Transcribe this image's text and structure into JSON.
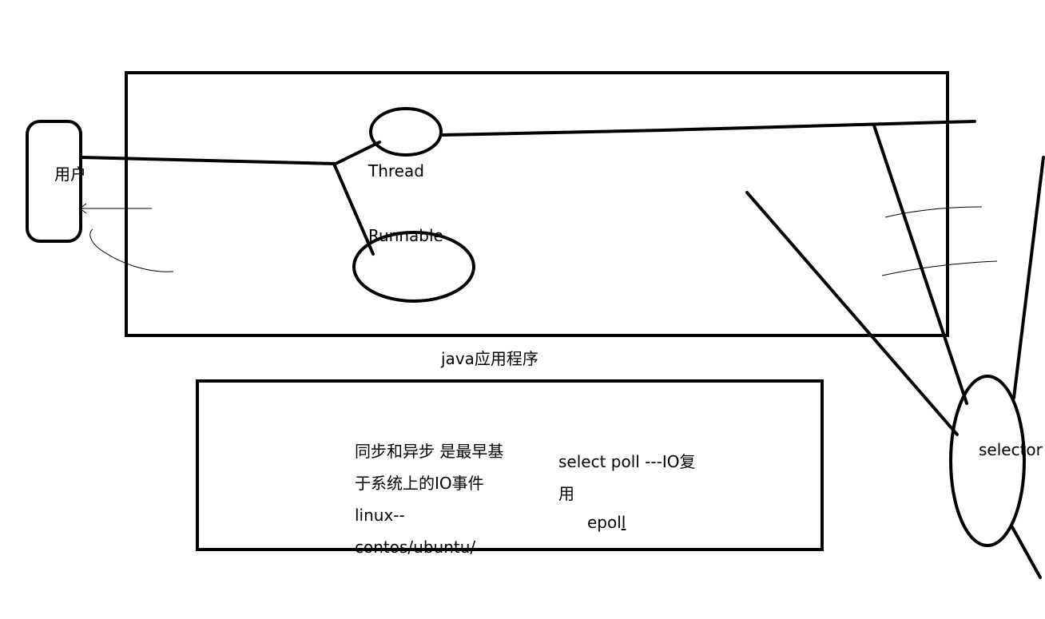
{
  "labels": {
    "user": "用户",
    "thread": "Thread",
    "runnable": "Runnable",
    "java_app": "java应用程序",
    "selector": "selector"
  },
  "notes": {
    "sync_lines": [
      "同步和异步 是最早基",
      "于系统上的IO事件",
      " linux--",
      "contos/ubuntu/"
    ],
    "io_line1": "select   poll ---IO复",
    "io_line2": "用",
    "epoll_prefix": "epol",
    "epoll_suffix": "l"
  },
  "colors": {
    "stroke": "#000000",
    "background": "#ffffff"
  }
}
